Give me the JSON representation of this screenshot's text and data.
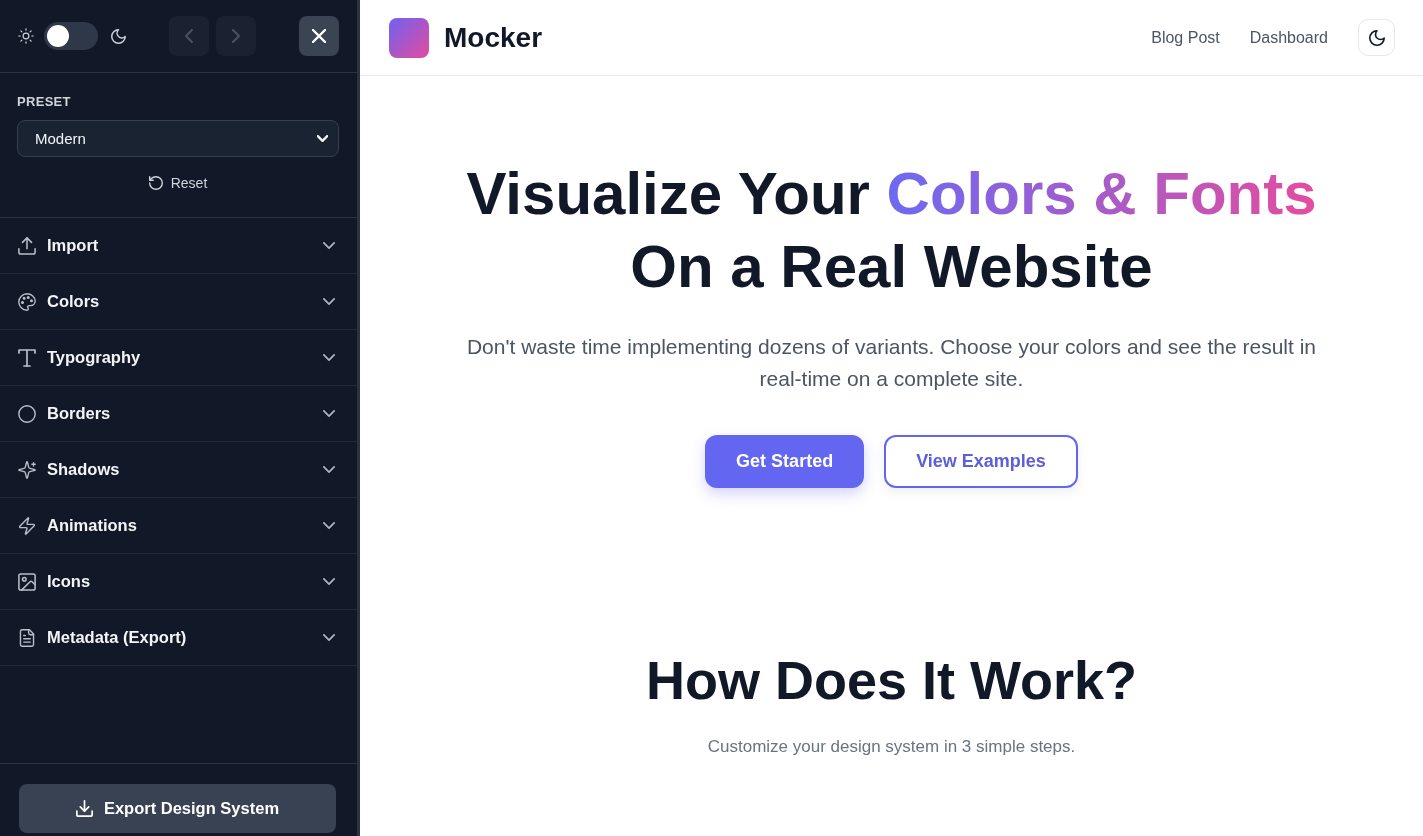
{
  "sidebar": {
    "theme_switch": {
      "on": false
    },
    "history_buttons": [
      {
        "kind": "back",
        "disabled": true
      },
      {
        "kind": "forward",
        "disabled": true
      }
    ],
    "preset": {
      "label": "PRESET",
      "value": "Modern"
    },
    "reset_button": "Reset",
    "sections": [
      {
        "label": "Import",
        "expanded": false
      },
      {
        "label": "Colors",
        "expanded": false
      },
      {
        "label": "Typography",
        "expanded": false
      },
      {
        "label": "Borders",
        "expanded": false
      },
      {
        "label": "Shadows",
        "expanded": false
      },
      {
        "label": "Animations",
        "expanded": false
      },
      {
        "label": "Icons",
        "expanded": false
      },
      {
        "label": "Metadata (Export)",
        "expanded": false
      }
    ],
    "export_button": "Export Design System"
  },
  "header": {
    "brand": "Mocker",
    "nav_links": [
      "Blog Post",
      "Dashboard"
    ]
  },
  "hero": {
    "title_start": "Visualize Your ",
    "title_highlight": "Colors & Fonts",
    "title_end": "On a Real Website",
    "subtitle": "Don't waste time implementing dozens of variants. Choose your colors and see the result in real-time on a complete site.",
    "buttons": [
      {
        "label": "Get Started",
        "kind": "primary"
      },
      {
        "label": "View Examples",
        "kind": "outline"
      }
    ]
  },
  "how_it_works": {
    "title": "How Does It Work?",
    "subtitle": "Customize your design system in 3 simple steps."
  }
}
